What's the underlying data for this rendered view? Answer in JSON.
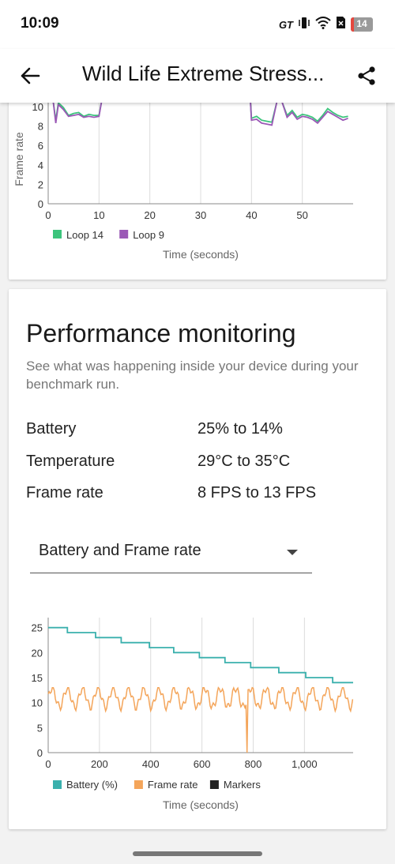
{
  "status_bar": {
    "time": "10:09",
    "brand_badge": "GT",
    "battery_level": "14",
    "battery_fraction": 0.14,
    "icons": [
      "vibrate-icon",
      "wifi-icon",
      "sim-icon",
      "battery-icon"
    ]
  },
  "app_bar": {
    "title": "Wild Life Extreme Stress...",
    "back_icon": "arrow-left-icon",
    "share_icon": "share-icon"
  },
  "perf": {
    "heading": "Performance monitoring",
    "description": "See what was happening inside your device during your benchmark run.",
    "stats": [
      {
        "label": "Battery",
        "value": "25% to 14%"
      },
      {
        "label": "Temperature",
        "value": "29°C to 35°C"
      },
      {
        "label": "Frame rate",
        "value": "8 FPS to 13 FPS"
      }
    ],
    "dropdown_value": "Battery and Frame rate"
  },
  "chart_data": [
    {
      "type": "line",
      "ylabel": "Frame rate",
      "xlabel": "Time (seconds)",
      "xlim": [
        0,
        60
      ],
      "ylim": [
        0,
        10
      ],
      "x_ticks": [
        "0",
        "10",
        "20",
        "30",
        "40",
        "50"
      ],
      "y_ticks": [
        "0",
        "2",
        "4",
        "6",
        "8",
        "10"
      ],
      "grid": "vertical",
      "legend_position": "bottom-left",
      "series": [
        {
          "name": "Loop 14",
          "color": "#3cc47c",
          "x": [
            0,
            1,
            1.5,
            2,
            3,
            4,
            5,
            6,
            7,
            8,
            9,
            10,
            10.5,
            39.8,
            40,
            41,
            42,
            43,
            44,
            45,
            46,
            47,
            48,
            49,
            50,
            51,
            52,
            53,
            54,
            55,
            56,
            57,
            58,
            59
          ],
          "y": [
            10.5,
            10.5,
            8.6,
            10.4,
            9.9,
            9.1,
            9.3,
            9.4,
            9.0,
            9.2,
            9.1,
            9.1,
            10.5,
            10.5,
            8.8,
            9.0,
            8.6,
            8.5,
            8.4,
            10.5,
            10.5,
            9.1,
            9.6,
            8.9,
            9.2,
            9.1,
            8.9,
            8.5,
            9.1,
            9.8,
            9.4,
            9.1,
            8.9,
            9.0
          ]
        },
        {
          "name": "Loop 9",
          "color": "#9b59b6",
          "x": [
            0,
            1,
            1.5,
            2,
            3,
            4,
            5,
            6,
            7,
            8,
            9,
            10,
            10.5,
            39.8,
            40,
            41,
            42,
            43,
            44,
            45,
            46,
            47,
            48,
            49,
            50,
            51,
            52,
            53,
            54,
            55,
            56,
            57,
            58,
            59
          ],
          "y": [
            10.5,
            10.5,
            8.3,
            10.2,
            9.7,
            9.0,
            9.1,
            9.2,
            8.9,
            9.0,
            8.9,
            9.0,
            10.5,
            10.5,
            8.6,
            8.7,
            8.3,
            8.2,
            8.1,
            10.5,
            10.5,
            8.9,
            9.4,
            8.7,
            9.0,
            8.9,
            8.7,
            8.3,
            8.9,
            9.5,
            9.2,
            8.9,
            8.6,
            8.8
          ]
        }
      ]
    },
    {
      "type": "line",
      "xlabel": "Time (seconds)",
      "xlim": [
        0,
        1190
      ],
      "ylim": [
        0,
        27
      ],
      "x_ticks": [
        "0",
        "200",
        "400",
        "600",
        "800",
        "1,000"
      ],
      "y_ticks": [
        "0",
        "5",
        "10",
        "15",
        "20",
        "25"
      ],
      "grid": "vertical",
      "legend_position": "bottom-left",
      "legend": [
        {
          "name": "Battery (%)",
          "color": "#3ab0ad"
        },
        {
          "name": "Frame rate",
          "color": "#f4a55a"
        },
        {
          "name": "Markers",
          "color": "#222222"
        }
      ],
      "battery_steps": [
        {
          "x": 0,
          "y": 25
        },
        {
          "x": 75,
          "y": 24
        },
        {
          "x": 185,
          "y": 23
        },
        {
          "x": 285,
          "y": 22
        },
        {
          "x": 395,
          "y": 21
        },
        {
          "x": 490,
          "y": 20
        },
        {
          "x": 590,
          "y": 19
        },
        {
          "x": 690,
          "y": 18
        },
        {
          "x": 790,
          "y": 17
        },
        {
          "x": 900,
          "y": 16
        },
        {
          "x": 1005,
          "y": 15
        },
        {
          "x": 1110,
          "y": 14
        },
        {
          "x": 1190,
          "y": 14
        }
      ],
      "frame_rate": {
        "range": [
          8,
          13
        ],
        "drop_at_x": 775,
        "drop_to": 0
      }
    }
  ]
}
